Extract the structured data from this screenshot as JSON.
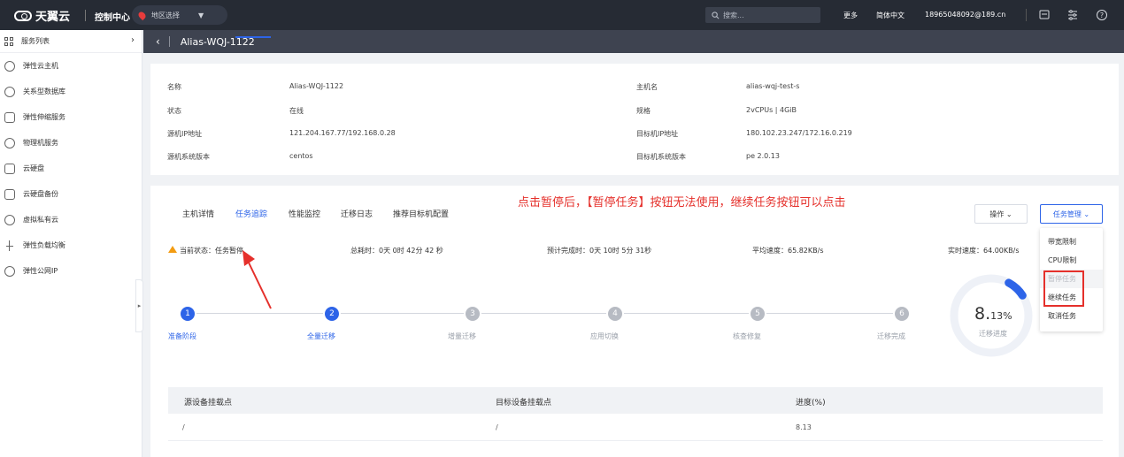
{
  "topbar": {
    "logo": "天翼云",
    "console": "控制中心",
    "region": "地区选择",
    "search_placeholder": "搜索...",
    "more": "更多",
    "language": "简体中文",
    "account": "18965048092@189.cn"
  },
  "sidebar": {
    "header": "服务列表",
    "items": [
      {
        "label": "弹性云主机",
        "icon": "cloud-host-icon"
      },
      {
        "label": "关系型数据库",
        "icon": "database-icon"
      },
      {
        "label": "弹性伸缩服务",
        "icon": "scaling-icon"
      },
      {
        "label": "物理机服务",
        "icon": "physical-server-icon"
      },
      {
        "label": "云硬盘",
        "icon": "disk-icon"
      },
      {
        "label": "云硬盘备份",
        "icon": "disk-backup-icon"
      },
      {
        "label": "虚拟私有云",
        "icon": "vpc-icon"
      },
      {
        "label": "弹性负载均衡",
        "icon": "load-balancer-icon"
      },
      {
        "label": "弹性公网IP",
        "icon": "eip-icon"
      }
    ]
  },
  "subheader": {
    "title": "Alias-WQJ-1122"
  },
  "info": {
    "name_label": "名称",
    "name_value": "Alias-WQJ-1122",
    "state_label": "状态",
    "state_value": "在线",
    "src_ip_label": "源机IP地址",
    "src_ip_value": "121.204.167.77/192.168.0.28",
    "src_os_label": "源机系统版本",
    "src_os_value": "centos",
    "host_label": "主机名",
    "host_value": "alias-wqj-test-s",
    "spec_label": "规格",
    "spec_value": "2vCPUs | 4GiB",
    "dst_ip_label": "目标机IP地址",
    "dst_ip_value": "180.102.23.247/172.16.0.219",
    "dst_os_label": "目标机系统版本",
    "dst_os_value": "pe 2.0.13"
  },
  "tabs": [
    "主机详情",
    "任务追踪",
    "性能监控",
    "迁移日志",
    "推荐目标机配置"
  ],
  "active_tab": 1,
  "annotation": "点击暂停后，【暂停任务】按钮无法使用，继续任务按钮可以点击",
  "buttons": {
    "ops": "操作 ⌄",
    "task": "任务管理 ⌄"
  },
  "task_menu": [
    {
      "label": "带宽限制",
      "disabled": false
    },
    {
      "label": "CPU限制",
      "disabled": false
    },
    {
      "label": "暂停任务",
      "disabled": true
    },
    {
      "label": "继续任务",
      "disabled": false
    },
    {
      "label": "取消任务",
      "disabled": false
    }
  ],
  "status": {
    "current": "当前状态：任务暂停",
    "elapsed": "总耗时：0天 0时 42分 42 秒",
    "eta": "预计完成时：0天 10时 5分 31秒",
    "avg_speed": "平均速度：65.82KB/s",
    "rt_speed": "实时速度：64.00KB/s"
  },
  "steps": [
    {
      "num": "1",
      "label": "准备阶段",
      "done": true
    },
    {
      "num": "2",
      "label": "全量迁移",
      "done": true
    },
    {
      "num": "3",
      "label": "增量迁移",
      "done": false
    },
    {
      "num": "4",
      "label": "应用切换",
      "done": false
    },
    {
      "num": "5",
      "label": "核查修复",
      "done": false
    },
    {
      "num": "6",
      "label": "迁移完成",
      "done": false
    }
  ],
  "progress": {
    "value_int": "8.",
    "value_dec": "13%",
    "label": "迁移进度",
    "fraction": 0.0813
  },
  "table": {
    "headers": [
      "源设备挂载点",
      "目标设备挂载点",
      "进度(%)"
    ],
    "rows": [
      [
        "/",
        "/",
        "8.13"
      ]
    ]
  }
}
